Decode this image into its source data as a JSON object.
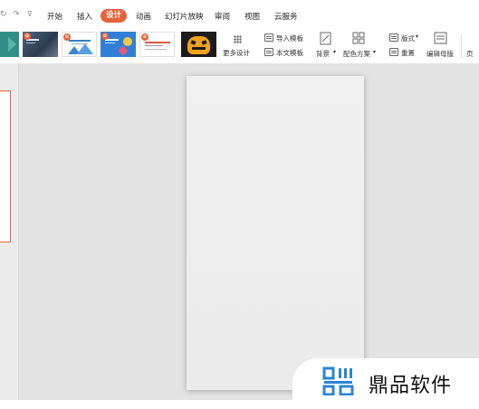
{
  "quick_access": {
    "redo_icon": "redo-icon",
    "customize_icon": "customize-dropdown-icon"
  },
  "menu": {
    "tabs": [
      {
        "label": "开始",
        "active": false
      },
      {
        "label": "插入",
        "active": false
      },
      {
        "label": "设计",
        "active": true
      },
      {
        "label": "动画",
        "active": false
      },
      {
        "label": "幻灯片放映",
        "active": false
      },
      {
        "label": "审阅",
        "active": false
      },
      {
        "label": "视图",
        "active": false
      },
      {
        "label": "云服务",
        "active": false
      }
    ],
    "accent_color": "#e8623a"
  },
  "ribbon": {
    "more_design": "更多设计",
    "import_template": "导入模板",
    "this_template": "本文模板",
    "background": "背景",
    "color_scheme": "配色方案",
    "layout": "版式",
    "reset": "重置",
    "edit_master": "编辑母版",
    "cut_off_label": "页",
    "dropdown_glyph": "▾"
  },
  "watermark": {
    "brand": "鼎品软件"
  }
}
